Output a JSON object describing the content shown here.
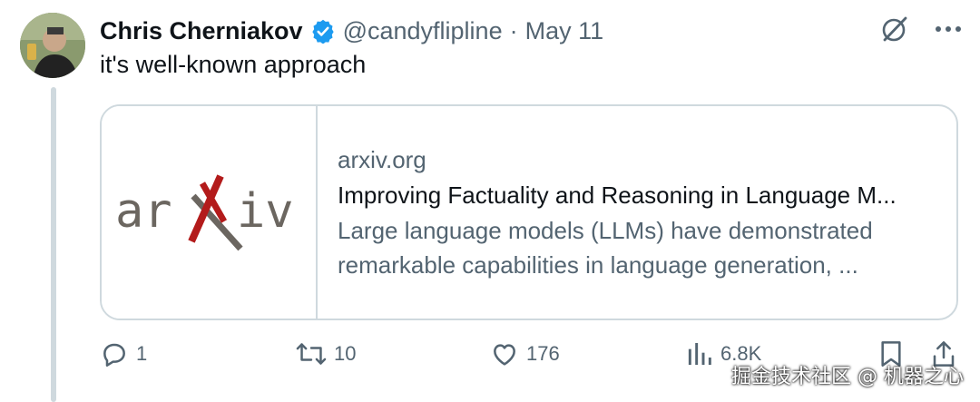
{
  "tweet": {
    "author_name": "Chris Cherniakov",
    "handle": "@candyflipline",
    "separator": "·",
    "date": "May 11",
    "text": "it's well-known approach",
    "verified_color": "#1d9bf0"
  },
  "card": {
    "logo_text_left": "ar",
    "logo_text_right": "iv",
    "domain": "arxiv.org",
    "title": "Improving Factuality and Reasoning in Language M...",
    "description_line1": "Large language models (LLMs) have demonstrated",
    "description_line2": "remarkable capabilities in language generation, ..."
  },
  "actions": {
    "replies": "1",
    "reposts": "10",
    "likes": "176",
    "views": "6.8K"
  },
  "icons": {
    "top": [
      "grok-icon",
      "more-icon"
    ],
    "actions": [
      "reply-icon",
      "repost-icon",
      "like-icon",
      "views-icon",
      "bookmark-icon",
      "share-icon"
    ]
  },
  "watermark": "掘金技术社区 @ 机器之心"
}
